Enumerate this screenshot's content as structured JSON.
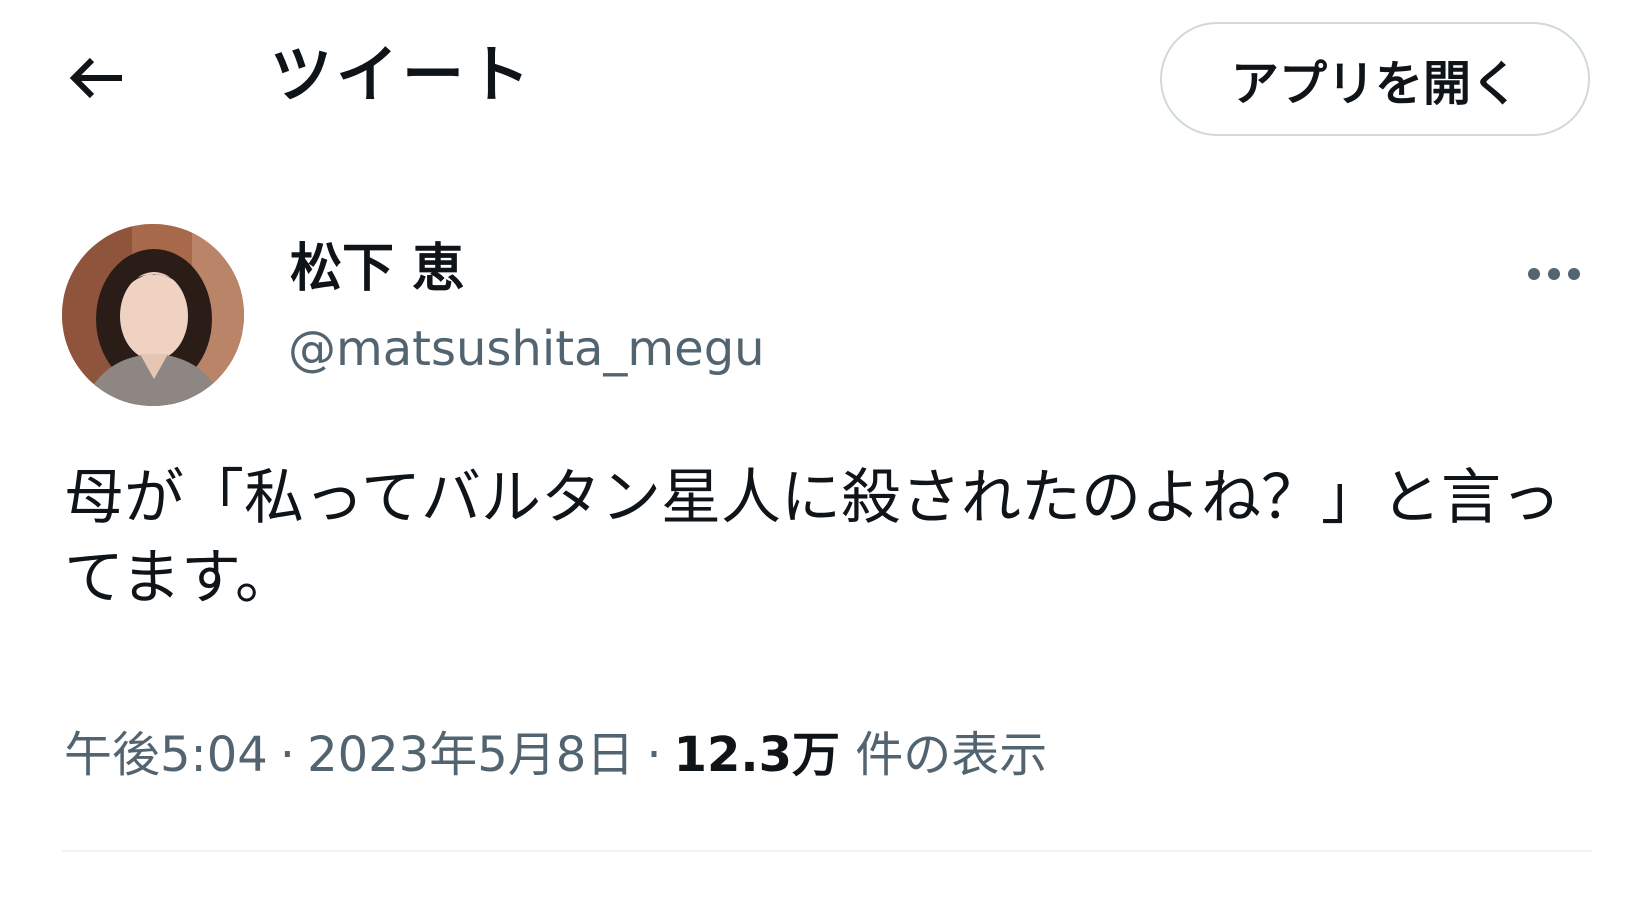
{
  "header": {
    "title": "ツイート",
    "open_app_label": "アプリを開く"
  },
  "tweet": {
    "author_name": "松下 恵",
    "author_handle": "@matsushita_megu",
    "text": "母が「私ってバルタン星人に殺されたのよね？」と言ってます。",
    "time": "午後5:04",
    "date": "2023年5月8日",
    "views_count": "12.3万",
    "views_label": "件の表示"
  },
  "icons": {
    "back": "arrow-left-icon",
    "more": "more-horizontal-icon"
  },
  "colors": {
    "primary_text": "#0f1419",
    "secondary_text": "#536471",
    "border": "#cfd9de",
    "divider": "#eff3f4"
  }
}
